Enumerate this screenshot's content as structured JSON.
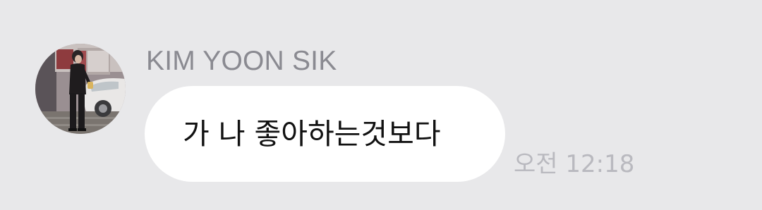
{
  "chat": {
    "message": {
      "sender_name": "KIM YOON SIK",
      "text": "가 나 좋아하는것보다",
      "time": "오전 12:18"
    },
    "avatar_icon": "profile-photo-icon"
  },
  "colors": {
    "background": "#e8e8ea",
    "bubble": "#ffffff",
    "sender_name": "#8a8a91",
    "message_text": "#111111",
    "timestamp": "#b9b9bf"
  }
}
